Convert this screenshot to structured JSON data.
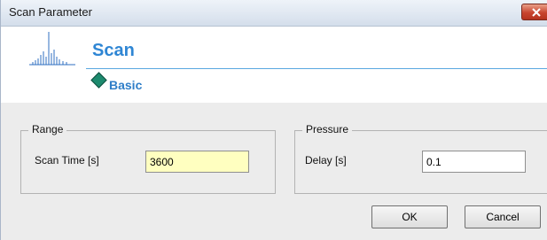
{
  "window": {
    "title": "Scan Parameter"
  },
  "header": {
    "title": "Scan",
    "subtitle": "Basic"
  },
  "range_group": {
    "legend": "Range",
    "scan_time_label": "Scan Time [s]",
    "scan_time_value": "3600"
  },
  "pressure_group": {
    "legend": "Pressure",
    "delay_label": "Delay [s]",
    "delay_value": "0.1"
  },
  "buttons": {
    "ok": "OK",
    "cancel": "Cancel"
  },
  "colors": {
    "heading": "#2f86d4",
    "accent_line": "#5aa8e0",
    "scan_time_bg": "#ffffc0",
    "close_button": "#c8452f",
    "diamond": "#1d8a6e"
  }
}
